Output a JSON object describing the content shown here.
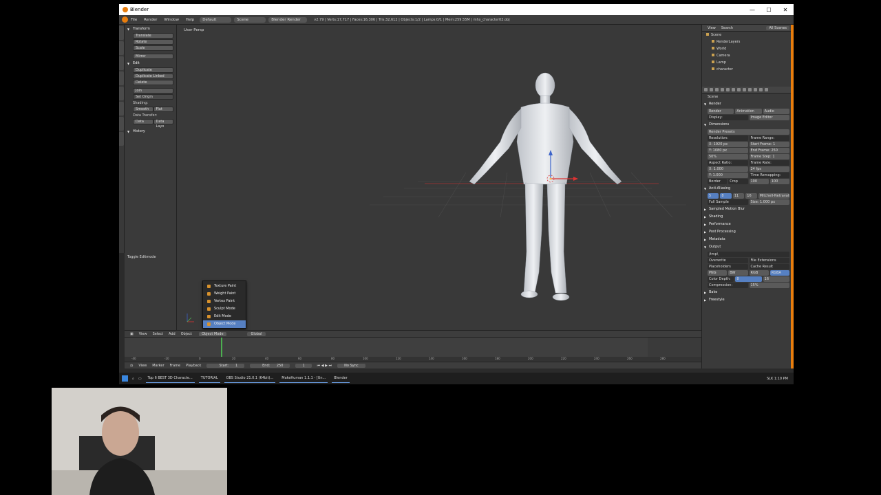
{
  "window": {
    "title": "Blender"
  },
  "info_header": {
    "menus": [
      "File",
      "Render",
      "Window",
      "Help"
    ],
    "screen_layout": "Default",
    "scene": "Scene",
    "render_engine": "Blender Render",
    "stats": "v2.79 | Verts:17,717 | Faces:16,306 | Tris:32,612 | Objects:1/2 | Lamps:0/1 | Mem:259.55M | mhx_character02.obj"
  },
  "tool_shelf": {
    "transform_header": "Transform",
    "transform_buttons": [
      "Translate",
      "Rotate",
      "Scale"
    ],
    "mirror_button": "Mirror",
    "edit_header": "Edit",
    "edit_buttons": [
      "Duplicate",
      "Duplicate Linked",
      "Delete"
    ],
    "join_button": "Join",
    "set_origin": "Set Origin",
    "shading_label": "Shading:",
    "shading_buttons": [
      "Smooth",
      "Flat"
    ],
    "data_transfer_label": "Data Transfer:",
    "data_transfer_buttons": [
      "Data",
      "Data Layo"
    ],
    "history_header": "History",
    "toggle_editmode": "Toggle Editmode"
  },
  "viewport": {
    "view_label": "User Persp"
  },
  "mode_menu": {
    "items": [
      "Texture Paint",
      "Weight Paint",
      "Vertex Paint",
      "Sculpt Mode",
      "Edit Mode",
      "Object Mode"
    ],
    "selected": "Object Mode"
  },
  "viewport_header": {
    "items": [
      "View",
      "Select",
      "Add",
      "Object"
    ],
    "mode": "Object Mode",
    "pivot": "Global"
  },
  "timeline_header": {
    "items": [
      "View",
      "Marker",
      "Frame",
      "Playback"
    ],
    "start": "Start:",
    "start_value": "1",
    "end": "End:",
    "end_value": "250",
    "current_frame": "1",
    "sync": "No Sync",
    "ruler_ticks": [
      "-40",
      "-20",
      "0",
      "20",
      "40",
      "60",
      "80",
      "100",
      "120",
      "140",
      "160",
      "180",
      "200",
      "220",
      "240",
      "260",
      "280"
    ]
  },
  "outliner": {
    "tabs": [
      "View",
      "Search",
      "All Scenes"
    ],
    "items": [
      "Scene",
      "RenderLayers",
      "World",
      "Camera",
      "Lamp",
      "character"
    ]
  },
  "properties": {
    "context": "Scene",
    "render_header": "Render",
    "render_buttons": [
      "Render",
      "Animation",
      "Audio"
    ],
    "display_label": "Display:",
    "display_value": "Image Editor",
    "dimensions_header": "Dimensions",
    "render_presets": "Render Presets",
    "resolution_label": "Resolution:",
    "frame_range_label": "Frame Range:",
    "res_x": "X: 1920 px",
    "res_y": "Y: 1080 px",
    "res_pct": "50%",
    "start_frame": "Start Frame: 1",
    "end_frame": "End Frame: 250",
    "frame_step": "Frame Step: 1",
    "aspect_label": "Aspect Ratio:",
    "frame_rate_label": "Frame Rate:",
    "aspect_x": "X: 1.000",
    "aspect_y": "Y: 1.000",
    "fps": "24 fps",
    "time_remapping": "Time Remapping:",
    "border": "Border",
    "crop": "Crop",
    "remap_old": "100",
    "remap_new": "100",
    "anti_aliasing": "Anti-Aliasing",
    "aa_values": [
      "5",
      "8",
      "11",
      "16"
    ],
    "aa_filter": "Mitchell-Netravali",
    "full_sample": "Full Sample",
    "aa_size": "Size: 1.000 px",
    "collapsed_panels": [
      "Sampled Motion Blur",
      "Shading",
      "Performance",
      "Post Processing",
      "Metadata"
    ],
    "output_header": "Output",
    "output_path": "/tmp\\",
    "overwrite": "Overwrite",
    "file_extensions": "File Extensions",
    "placeholders": "Placeholders",
    "cache_result": "Cache Result",
    "format": "PNG",
    "color_modes": [
      "BW",
      "RGB",
      "RGBA"
    ],
    "color_depth_label": "Color Depth:",
    "color_depth_values": [
      "8",
      "16"
    ],
    "compression_label": "Compression:",
    "compression_value": "15%",
    "bake_header": "Bake",
    "freestyle_header": "Freestyle"
  },
  "taskbar": {
    "tasks": [
      "Top 6 BEST 3D Characte...",
      "TUTORIAL",
      "OBS Studio 21.0.1 (64bit)...",
      "MakeHuman 1.1.1 - [Un...",
      "Blender"
    ],
    "language": "SLK",
    "time": "1:10 PM"
  }
}
